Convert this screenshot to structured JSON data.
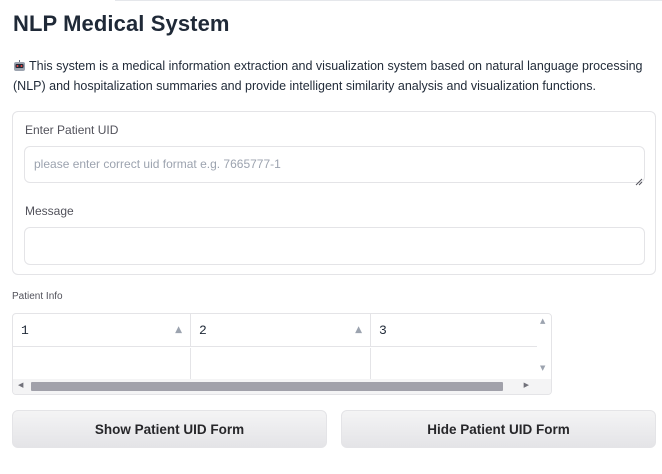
{
  "header": {
    "title": "NLP Medical System"
  },
  "description": {
    "icon": "robot-icon",
    "text": "This system is a medical information extraction and visualization system based on natural language processing (NLP) and hospitalization summaries and provide intelligent similarity analysis and visualization functions."
  },
  "form": {
    "uid_label": "Enter Patient UID",
    "uid_placeholder": "please enter correct uid format e.g. 7665777-1",
    "uid_value": "",
    "message_label": "Message",
    "message_value": ""
  },
  "patient_info": {
    "label": "Patient Info",
    "columns": [
      "1",
      "2",
      "3"
    ],
    "rows": [
      [
        "",
        "",
        ""
      ]
    ]
  },
  "buttons": {
    "show_label": "Show Patient UID Form",
    "hide_label": "Hide Patient UID Form"
  },
  "colors": {
    "border": "#e4e4e7",
    "button_bg": "#f4f4f5",
    "scrollbar_thumb": "#a1a1aa"
  }
}
